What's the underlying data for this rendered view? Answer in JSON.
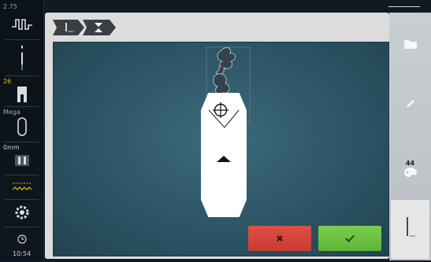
{
  "status": {
    "tension_value": "2.75",
    "foot_number": "26",
    "stitch_plate_label": "Mega",
    "feed_label": "0mm",
    "clock": "10:54"
  },
  "right_toolbar": {
    "color_count": "44"
  },
  "colors": {
    "cancel": "#d9473c",
    "confirm": "#6cc142",
    "canvas": "#2f5a6b",
    "accent_yellow": "#e7c200"
  }
}
